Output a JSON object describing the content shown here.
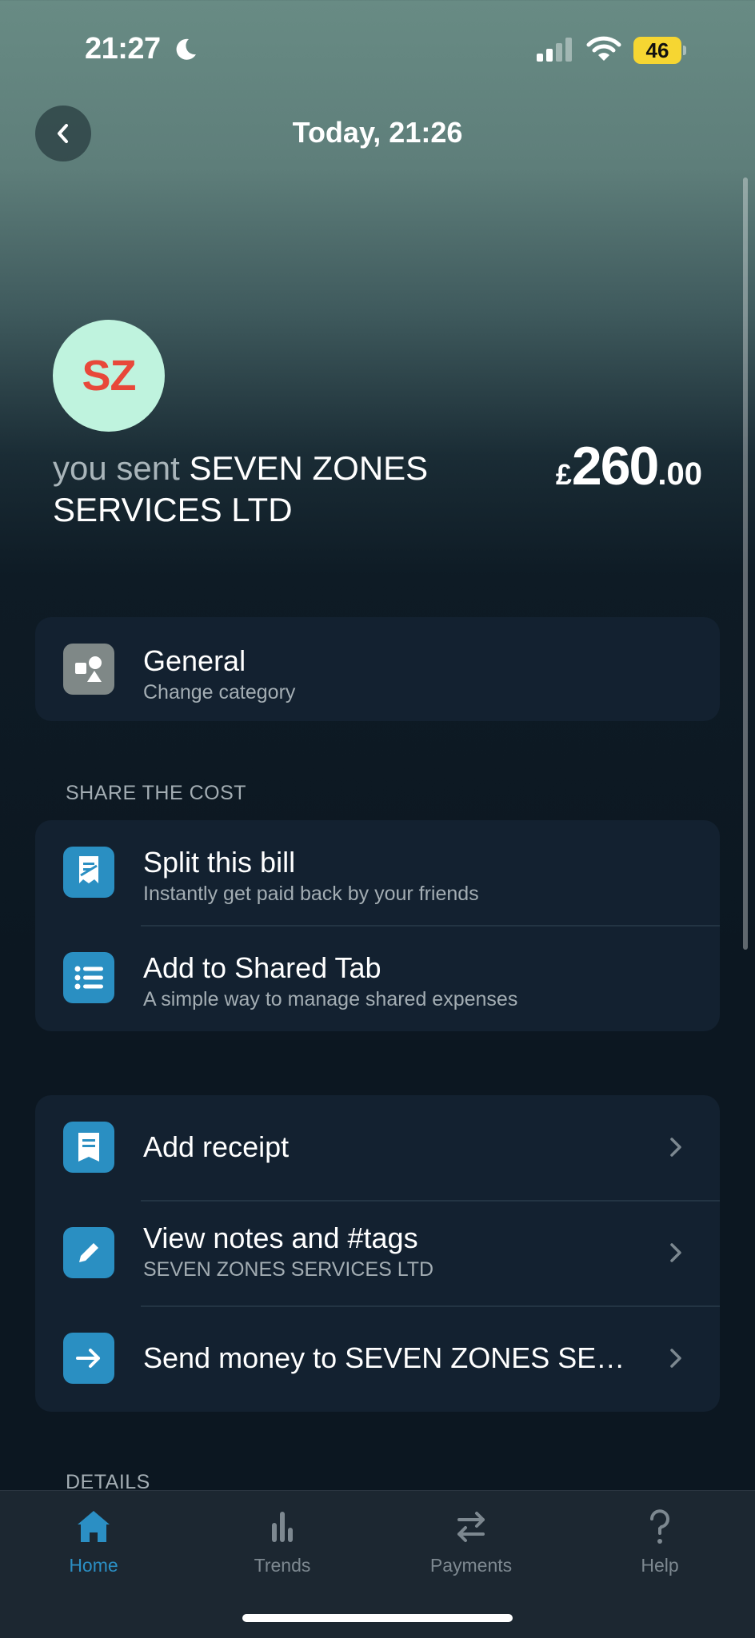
{
  "status_bar": {
    "time": "21:27",
    "battery": "46"
  },
  "header": {
    "title": "Today, 21:26"
  },
  "transaction": {
    "avatar_initials": "SZ",
    "prefix": "you sent",
    "merchant": "SEVEN ZONES SERVICES LTD",
    "amount": {
      "currency": "£",
      "major": "260",
      "minor": ".00"
    }
  },
  "category": {
    "title": "General",
    "subtitle": "Change category"
  },
  "share_section": {
    "label": "SHARE THE COST",
    "items": [
      {
        "title": "Split this bill",
        "subtitle": "Instantly get paid back by your friends"
      },
      {
        "title": "Add to Shared Tab",
        "subtitle": "A simple way to manage shared expenses"
      }
    ]
  },
  "actions": {
    "items": [
      {
        "title": "Add receipt"
      },
      {
        "title": "View notes and #tags",
        "subtitle": "SEVEN ZONES SERVICES LTD"
      },
      {
        "title": "Send money to SEVEN ZONES SE…"
      }
    ]
  },
  "details_label": "DETAILS",
  "tabs": [
    {
      "label": "Home",
      "icon": "home-icon",
      "active": true
    },
    {
      "label": "Trends",
      "icon": "trends-icon"
    },
    {
      "label": "Payments",
      "icon": "payments-icon"
    },
    {
      "label": "Help",
      "icon": "help-icon"
    }
  ],
  "colors": {
    "accent": "#2b8fc4",
    "avatar_bg": "#bff3de",
    "avatar_text": "#e8483a",
    "battery": "#f6d632"
  }
}
